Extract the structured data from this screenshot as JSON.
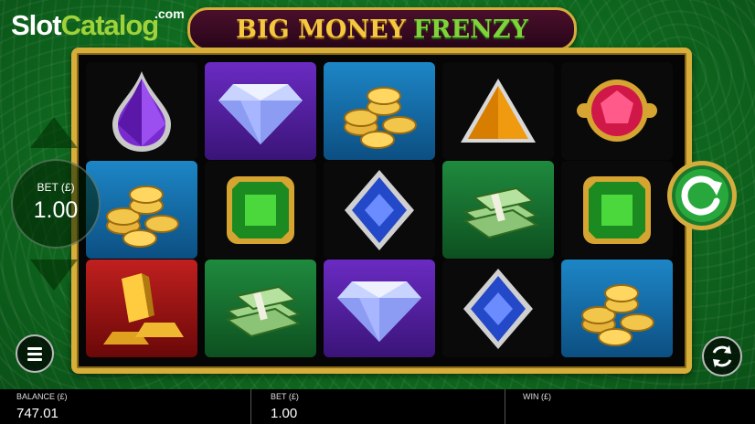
{
  "watermark": {
    "part1": "Slot",
    "part2": "Catalog",
    "suffix": ".com"
  },
  "title": {
    "word1": "BIG MONEY",
    "word2": "FRENZY"
  },
  "bet_widget": {
    "label": "BET (£)",
    "value": "1.00"
  },
  "bottom_bar": {
    "balance_label": "BALANCE (£)",
    "balance_value": "747.01",
    "bet_label": "BET (£)",
    "bet_value": "1.00",
    "win_label": "WIN (£)",
    "win_value": ""
  },
  "reels": [
    [
      "purple-gem",
      "blue-coins",
      "gold-bars"
    ],
    [
      "purple-diamond",
      "green-emerald",
      "green-cash"
    ],
    [
      "blue-coins",
      "blue-diamond",
      "purple-diamond"
    ],
    [
      "orange-triangle",
      "green-cash",
      "blue-diamond"
    ],
    [
      "pink-gem",
      "green-emerald",
      "blue-coins"
    ]
  ],
  "colors": {
    "frame_gold": "#d7ae3a",
    "felt_green": "#1f8a2c",
    "title_gold": "#f5c842",
    "title_green": "#7fd33a"
  }
}
